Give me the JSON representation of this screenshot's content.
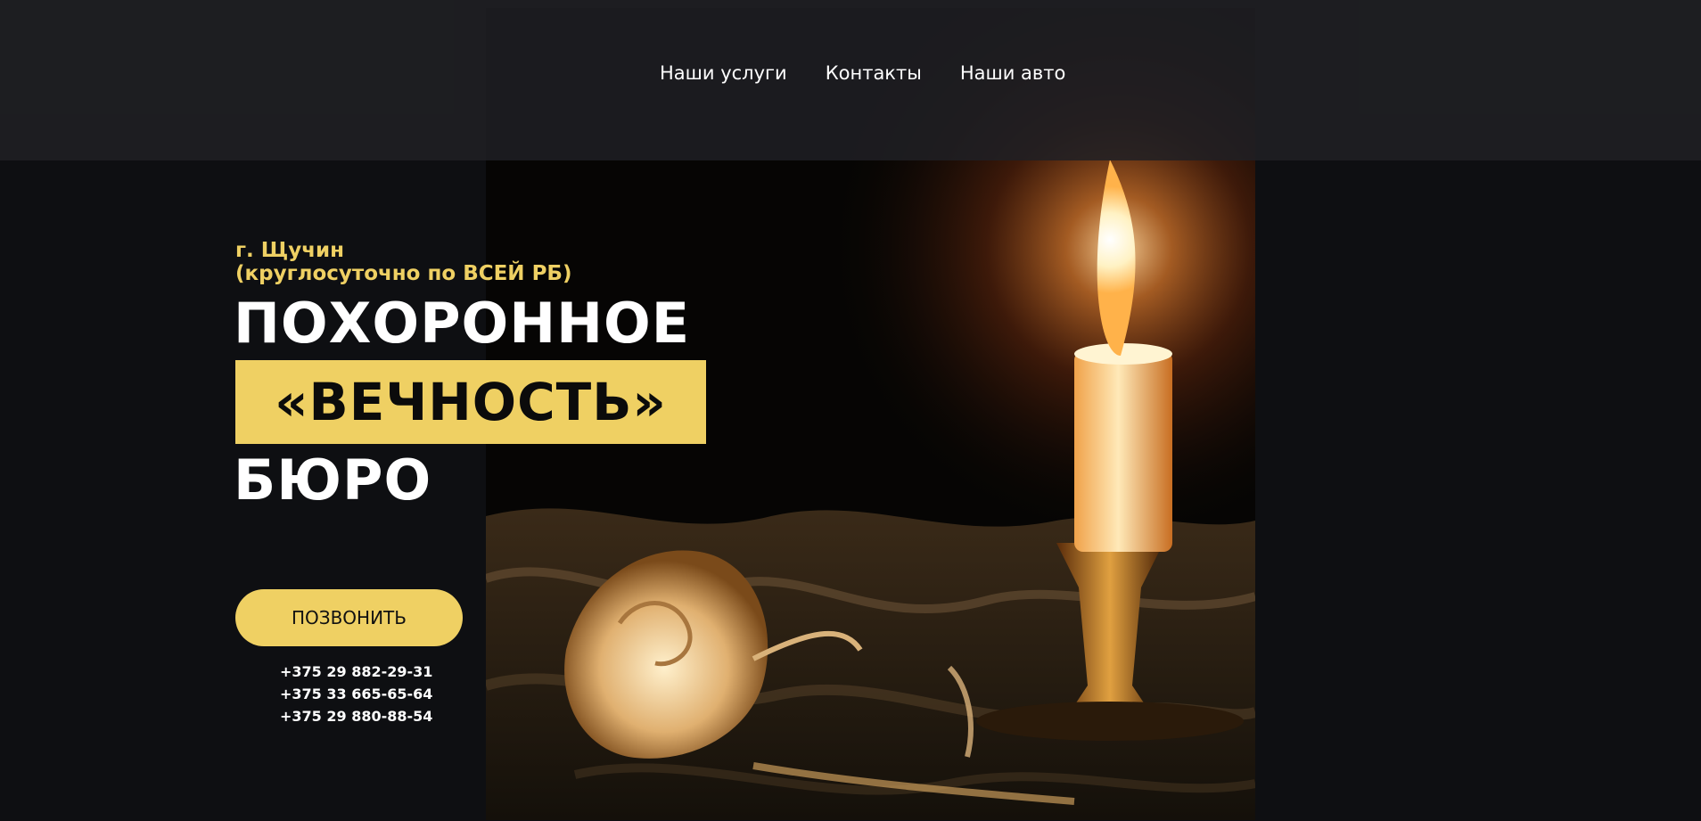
{
  "nav": {
    "items": [
      {
        "label": "Наши услуги"
      },
      {
        "label": "Контакты"
      },
      {
        "label": "Наши авто"
      }
    ]
  },
  "hero": {
    "city_line": "г. Щучин",
    "service_line": "(круглосуточно по ВСЕЙ РБ)",
    "title_line1": "ПОХОРОННОЕ",
    "title_line2": "«ВЕЧНОСТЬ»",
    "title_line3": "БЮРО",
    "call_button_label": "ПОЗВОНИТЬ",
    "phones": [
      "+375 29 882-29-31",
      "+375 33 665-65-64",
      "+375 29 880-88-54"
    ],
    "image_subject": "candle-and-rose-photo"
  },
  "colors": {
    "accent": "#efd063",
    "background": "#0e0f12",
    "header_bg": "#1f2024",
    "text_light": "#ffffff"
  }
}
